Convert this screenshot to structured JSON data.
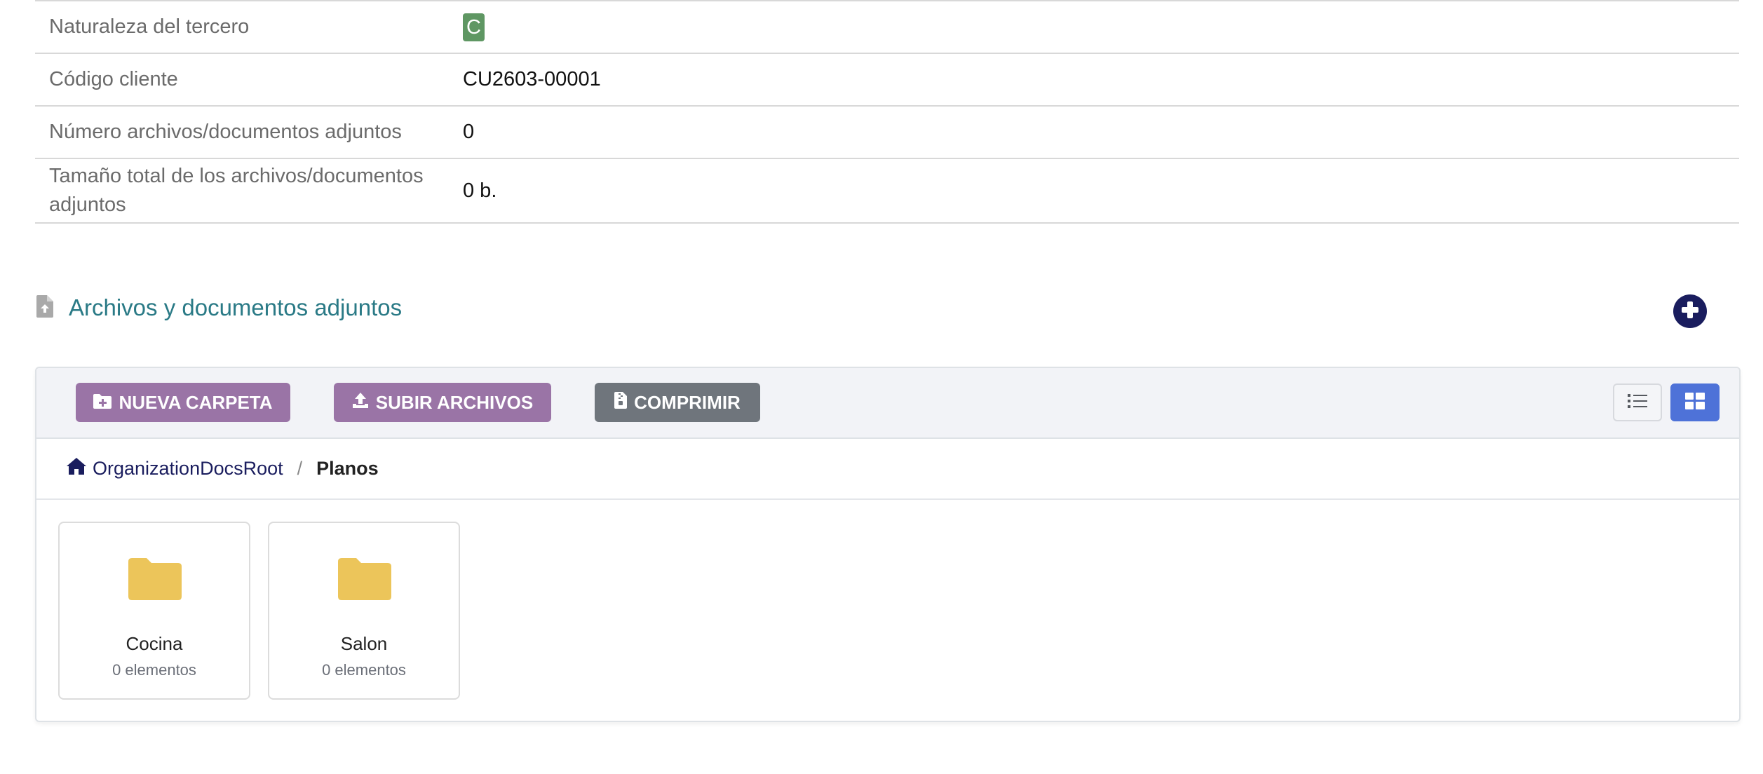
{
  "attributes": [
    {
      "label": "Naturaleza del tercero",
      "value": "C",
      "badge_color": "#5f9763"
    },
    {
      "label": "Código cliente",
      "value": "CU2603-00001"
    },
    {
      "label": "Número archivos/documentos adjuntos",
      "value": "0"
    },
    {
      "label": "Tamaño total de los archivos/documentos adjuntos",
      "value": "0 b."
    }
  ],
  "section": {
    "title": "Archivos y documentos adjuntos",
    "icon": "file-upload-icon",
    "add_icon": "plus-circle-icon"
  },
  "toolbar": {
    "new_folder_label": "NUEVA CARPETA",
    "upload_label": "SUBIR ARCHIVOS",
    "compress_label": "COMPRIMIR",
    "active_view": "grid"
  },
  "breadcrumb": {
    "root": "OrganizationDocsRoot",
    "separator": "/",
    "current": "Planos"
  },
  "folders": [
    {
      "name": "Cocina",
      "count": "0 elementos"
    },
    {
      "name": "Salon",
      "count": "0 elementos"
    }
  ],
  "colors": {
    "accent_teal": "#2a7a86",
    "navy": "#1a1d5e",
    "purple_button": "#9a74a6",
    "gray_button": "#6f757c",
    "grid_view_active": "#4e72d8",
    "folder_yellow": "#ecc55a"
  }
}
